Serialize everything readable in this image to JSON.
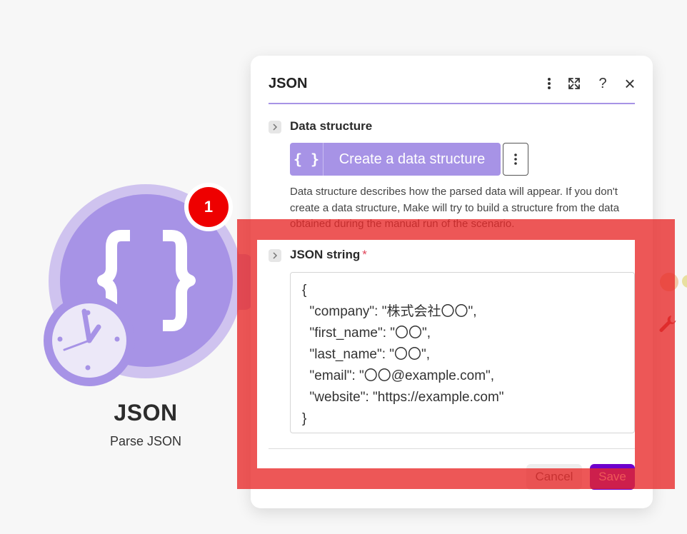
{
  "canvas": {
    "module": {
      "title": "JSON",
      "subtitle": "Parse JSON",
      "badge": "1",
      "icon": "curly-braces-icon",
      "trigger_icon": "clock-icon"
    }
  },
  "panel": {
    "title": "JSON",
    "header_icons": [
      "more-vertical-icon",
      "expand-icon",
      "help-icon",
      "close-icon"
    ],
    "help_glyph": "?",
    "close_glyph": "×",
    "data_structure": {
      "label": "Data structure",
      "button_label": "Create a data structure",
      "button_icon": "{ }",
      "help_text": "Data structure describes how the parsed data will appear. If you don't create a data structure, Make will try to build a structure from the data obtained during the manual run of the scenario."
    },
    "json_string": {
      "label": "JSON string",
      "required_mark": "*",
      "lines": [
        "{",
        "  \"company\": \"株式会社〇〇\",",
        "  \"first_name\": \"〇〇\",",
        "  \"last_name\": \"〇〇\",",
        "  \"email\": \"〇〇@example.com\",",
        "  \"website\": \"https://example.com\"",
        "}"
      ]
    },
    "footer": {
      "cancel_label": "Cancel",
      "save_label": "Save"
    }
  },
  "colors": {
    "brand_purple": "#a793e6",
    "save_purple": "#6d00cc",
    "badge_red": "#ee0000",
    "highlight_red": "#e82828"
  }
}
